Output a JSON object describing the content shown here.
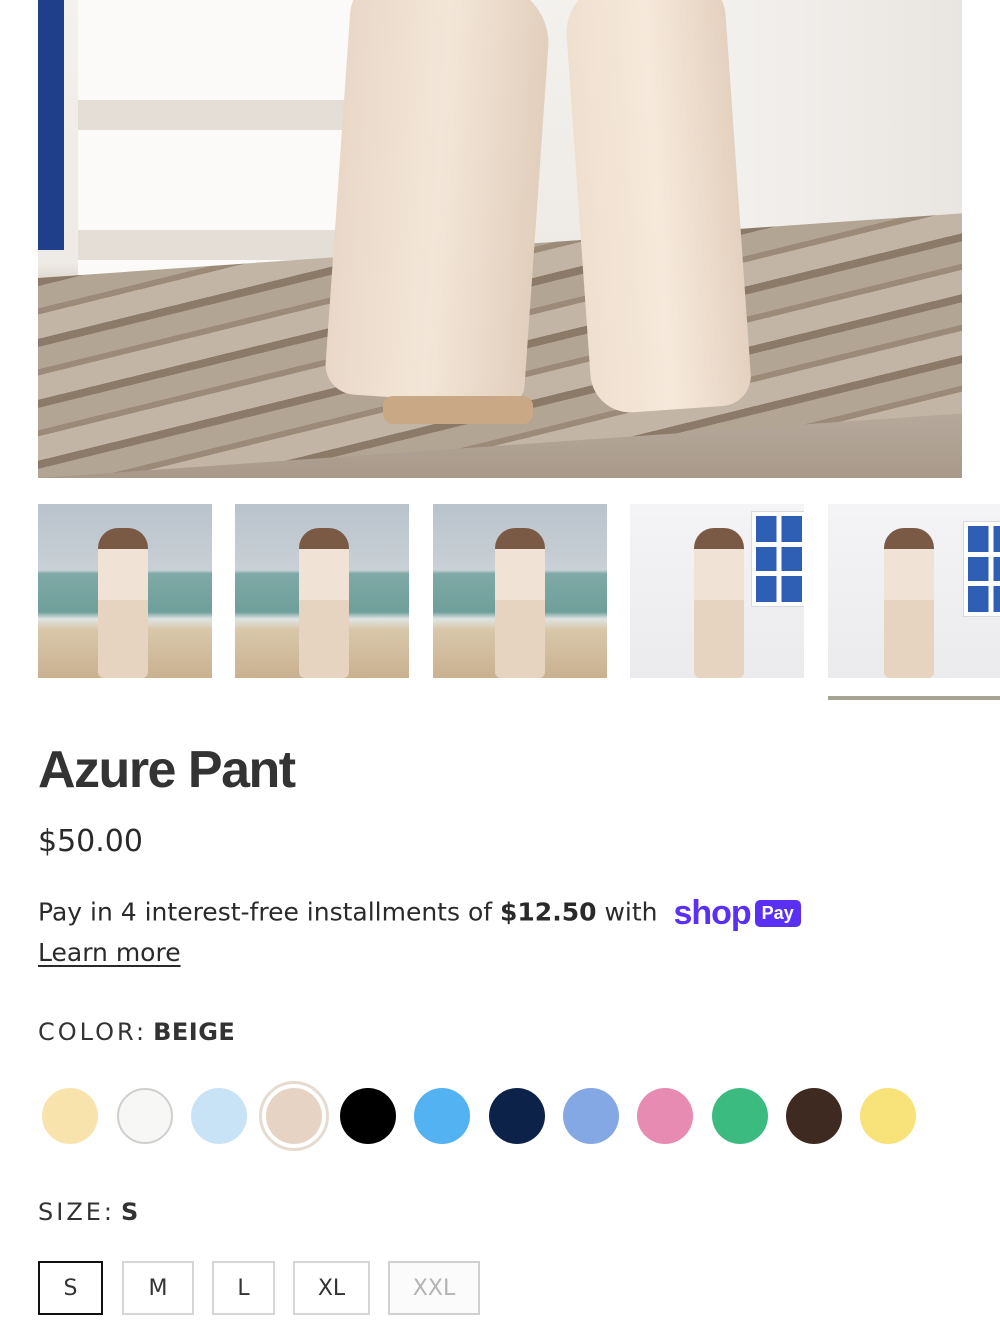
{
  "product": {
    "title": "Azure Pant",
    "price": "$50.00"
  },
  "installments": {
    "prefix": "Pay in 4 interest-free installments of",
    "amount": "$12.50",
    "suffix": "with",
    "provider_wordmark": "shop",
    "provider_badge": "Pay",
    "learn_more": "Learn more"
  },
  "gallery": {
    "thumbnails": [
      {
        "scene": "beach"
      },
      {
        "scene": "beach"
      },
      {
        "scene": "beach"
      },
      {
        "scene": "white-stairs"
      },
      {
        "scene": "white-stairs",
        "active": true
      }
    ]
  },
  "color": {
    "label": "COLOR:",
    "selected": "BEIGE",
    "swatches": [
      {
        "hex": "#f9e3ad"
      },
      {
        "hex": "#f7f7f5"
      },
      {
        "hex": "#c9e3f6"
      },
      {
        "hex": "#e6d3c4",
        "selected": true
      },
      {
        "hex": "#000000"
      },
      {
        "hex": "#53b2f1"
      },
      {
        "hex": "#0d2249"
      },
      {
        "hex": "#84a8e4"
      },
      {
        "hex": "#e78bb3"
      },
      {
        "hex": "#3cbb81"
      },
      {
        "hex": "#3f2a22"
      },
      {
        "hex": "#f8e27a"
      }
    ]
  },
  "size": {
    "label": "SIZE:",
    "selected": "S",
    "options": [
      {
        "label": "S",
        "selected": true
      },
      {
        "label": "M"
      },
      {
        "label": "L"
      },
      {
        "label": "XL"
      },
      {
        "label": "XXL",
        "disabled": true
      }
    ]
  }
}
